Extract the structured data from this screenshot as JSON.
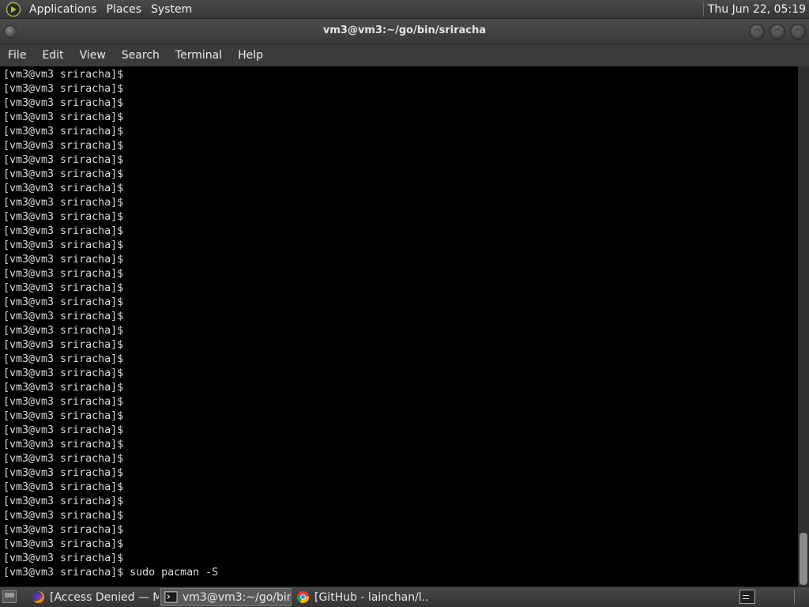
{
  "top_panel": {
    "menus": [
      "Applications",
      "Places",
      "System"
    ],
    "clock": "Thu Jun 22, 05:19"
  },
  "window": {
    "title": "vm3@vm3:~/go/bin/sriracha"
  },
  "menu_bar": {
    "items": [
      "File",
      "Edit",
      "View",
      "Search",
      "Terminal",
      "Help"
    ]
  },
  "terminal": {
    "lines": [
      "[vm3@vm3 sriracha]$",
      "[vm3@vm3 sriracha]$",
      "[vm3@vm3 sriracha]$",
      "[vm3@vm3 sriracha]$",
      "[vm3@vm3 sriracha]$",
      "[vm3@vm3 sriracha]$",
      "[vm3@vm3 sriracha]$",
      "[vm3@vm3 sriracha]$",
      "[vm3@vm3 sriracha]$",
      "[vm3@vm3 sriracha]$",
      "[vm3@vm3 sriracha]$",
      "[vm3@vm3 sriracha]$",
      "[vm3@vm3 sriracha]$",
      "[vm3@vm3 sriracha]$",
      "[vm3@vm3 sriracha]$",
      "[vm3@vm3 sriracha]$",
      "[vm3@vm3 sriracha]$",
      "[vm3@vm3 sriracha]$",
      "[vm3@vm3 sriracha]$",
      "[vm3@vm3 sriracha]$",
      "[vm3@vm3 sriracha]$",
      "[vm3@vm3 sriracha]$",
      "[vm3@vm3 sriracha]$",
      "[vm3@vm3 sriracha]$",
      "[vm3@vm3 sriracha]$",
      "[vm3@vm3 sriracha]$",
      "[vm3@vm3 sriracha]$",
      "[vm3@vm3 sriracha]$",
      "[vm3@vm3 sriracha]$",
      "[vm3@vm3 sriracha]$",
      "[vm3@vm3 sriracha]$",
      "[vm3@vm3 sriracha]$",
      "[vm3@vm3 sriracha]$",
      "[vm3@vm3 sriracha]$",
      "[vm3@vm3 sriracha]$",
      "[vm3@vm3 sriracha]$ sudo pacman -S"
    ],
    "scroll_position": 1.0,
    "visible_fraction": 0.1
  },
  "taskbar": {
    "tasks": [
      {
        "label": "[Access Denied — M...",
        "icon": "firefox-icon",
        "active": false
      },
      {
        "label": "vm3@vm3:~/go/bin...",
        "icon": "terminal-icon",
        "active": true
      },
      {
        "label": "[GitHub - lainchan/l...",
        "icon": "chrome-icon",
        "active": false
      }
    ]
  },
  "colors": {
    "panel": "#3b3b3b",
    "terminal_bg": "#000000",
    "terminal_fg": "#dcdcdc"
  }
}
